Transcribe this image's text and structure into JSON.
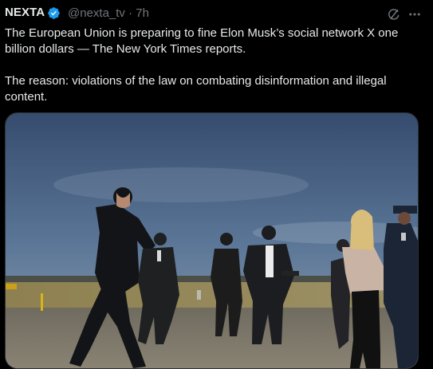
{
  "tweet": {
    "author_name": "NEXTA",
    "handle": "@nexta_tv",
    "separator": "·",
    "time": "7h",
    "verified_icon": "verified-badge-icon",
    "grok_icon": "grok-icon",
    "more_icon": "more-options-icon",
    "paragraph_1": "The European Union is preparing to fine Elon Musk’s social network X one billion dollars — The New York Times reports.",
    "paragraph_2": "The reason: violations of the law on combating disinformation and illegal content."
  },
  "colors": {
    "background": "#000000",
    "text": "#e7e9ea",
    "secondary_text": "#71767b",
    "verified": "#1d9bf0"
  }
}
